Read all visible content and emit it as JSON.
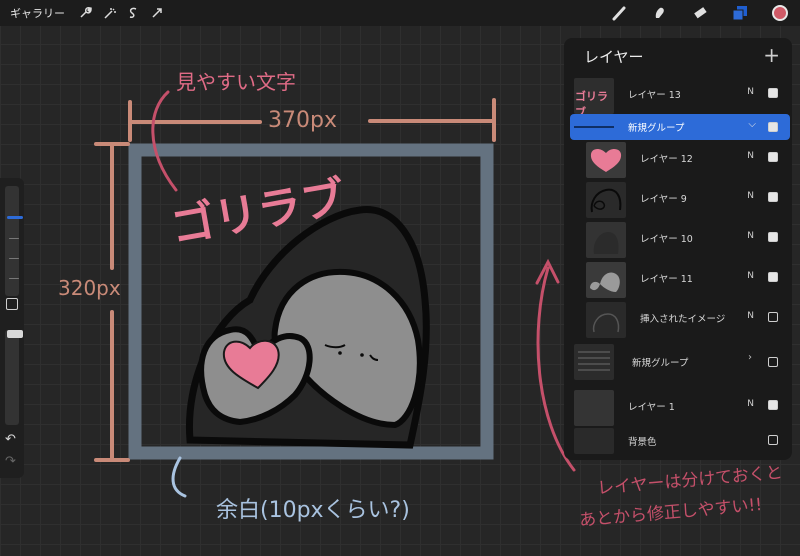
{
  "topbar": {
    "gallery_label": "ギャラリー",
    "left_tools": [
      "wrench-icon",
      "magic-wand-icon",
      "selection-icon",
      "transform-icon"
    ],
    "right_tools": [
      "brush-icon",
      "smudge-icon",
      "eraser-icon",
      "layers-icon"
    ],
    "color": "#d05a67",
    "accent": "#2d6bd8"
  },
  "annotations": {
    "font_note": "見やすい文字",
    "width_label": "370px",
    "height_label": "320px",
    "margin_note": "余白(10pxくらい?)",
    "layers_note_line1": "レイヤーは分けておくと",
    "layers_note_line2": "あとから修正しやすい!!",
    "logo_text": "ゴリラブ"
  },
  "layers_panel": {
    "title": "レイヤー",
    "add_label": "+",
    "rows": [
      {
        "name": "レイヤー 13",
        "mode": "N",
        "visible": true
      },
      {
        "name": "新規グループ",
        "mode": "",
        "visible": true,
        "selected": true
      },
      {
        "name": "レイヤー 12",
        "mode": "N",
        "visible": true
      },
      {
        "name": "レイヤー 9",
        "mode": "N",
        "visible": true
      },
      {
        "name": "レイヤー 10",
        "mode": "N",
        "visible": true
      },
      {
        "name": "レイヤー 11",
        "mode": "N",
        "visible": true
      },
      {
        "name": "挿入されたイメージ",
        "mode": "N",
        "visible": false
      },
      {
        "name": "新規グループ",
        "mode": "",
        "visible": false
      },
      {
        "name": "レイヤー 1",
        "mode": "N",
        "visible": true
      },
      {
        "name": "背景色",
        "mode": "",
        "visible": false
      }
    ]
  }
}
